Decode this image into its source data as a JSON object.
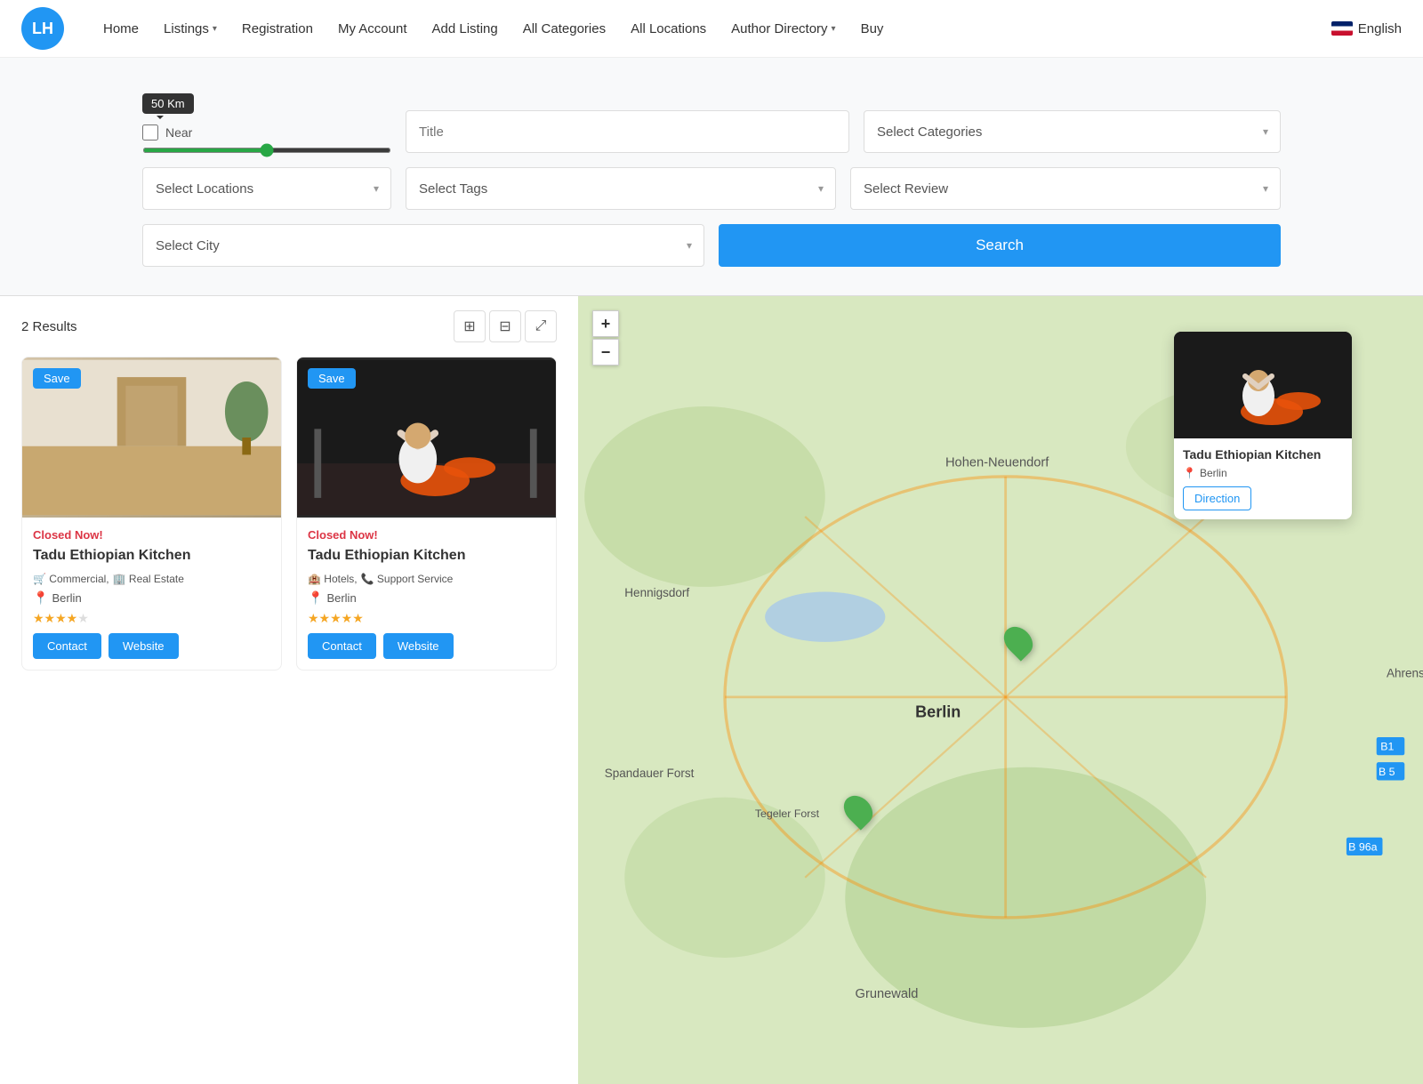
{
  "navbar": {
    "logo_text": "LH",
    "links": [
      {
        "label": "Home",
        "dropdown": false
      },
      {
        "label": "Listings",
        "dropdown": true
      },
      {
        "label": "Registration",
        "dropdown": false
      },
      {
        "label": "My Account",
        "dropdown": false
      },
      {
        "label": "Add Listing",
        "dropdown": false
      },
      {
        "label": "All Categories",
        "dropdown": false
      },
      {
        "label": "All Locations",
        "dropdown": false
      },
      {
        "label": "Author Directory",
        "dropdown": true
      },
      {
        "label": "Buy",
        "dropdown": false
      }
    ],
    "language": "English"
  },
  "search": {
    "km_tooltip": "50 Km",
    "near_label": "Near",
    "title_placeholder": "Title",
    "categories_placeholder": "Select Categories",
    "locations_placeholder": "Select Locations",
    "tags_placeholder": "Select Tags",
    "review_placeholder": "Select Review",
    "city_placeholder": "Select City",
    "search_button": "Search"
  },
  "results": {
    "count": "2 Results",
    "listings": [
      {
        "id": 1,
        "save_label": "Save",
        "closed_label": "Closed Now!",
        "title": "Tadu Ethiopian Kitchen",
        "categories": [
          {
            "icon": "🛒",
            "label": "Commercial"
          },
          {
            "icon": "🏢",
            "label": "Real Estate"
          }
        ],
        "location": "Berlin",
        "stars": 4,
        "max_stars": 5,
        "contact_label": "Contact",
        "website_label": "Website",
        "image_bg": "#c8b090"
      },
      {
        "id": 2,
        "save_label": "Save",
        "closed_label": "Closed Now!",
        "title": "Tadu Ethiopian Kitchen",
        "categories": [
          {
            "icon": "🏨",
            "label": "Hotels"
          },
          {
            "icon": "📞",
            "label": "Support Service"
          }
        ],
        "location": "Berlin",
        "stars": 5,
        "max_stars": 5,
        "contact_label": "Contact",
        "website_label": "Website",
        "image_bg": "#2a2a2a"
      }
    ]
  },
  "map": {
    "popup": {
      "title": "Tadu Ethiopian Kitchen",
      "location": "Berlin",
      "direction_label": "Direction"
    },
    "zoom_in": "+",
    "zoom_out": "−"
  }
}
